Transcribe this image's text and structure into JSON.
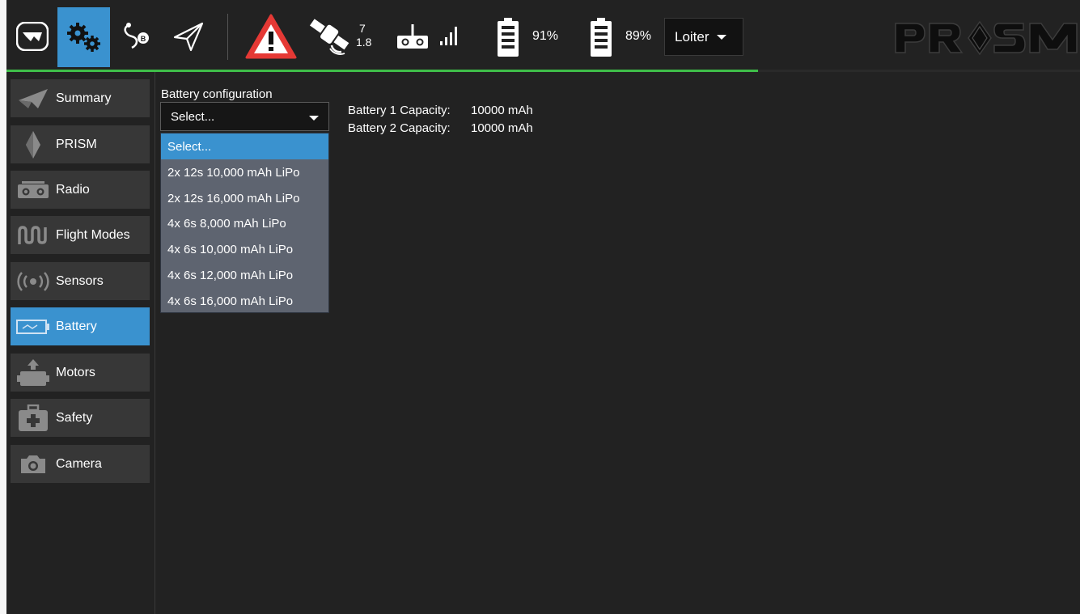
{
  "toolbar": {
    "gps_satellites": "7",
    "gps_hdop": "1.8",
    "battery1_percent": "91%",
    "battery2_percent": "89%",
    "flight_mode": "Loiter",
    "brand": "PRISM",
    "progress_fraction": 0.7,
    "colors": {
      "accent": "#3a92cf",
      "progress": "#3fbe49",
      "warning": "#e53935"
    }
  },
  "sidebar": {
    "items": [
      {
        "label": "Summary",
        "icon": "paper-plane-icon"
      },
      {
        "label": "PRISM",
        "icon": "prism-diamond-icon"
      },
      {
        "label": "Radio",
        "icon": "radio-icon"
      },
      {
        "label": "Flight Modes",
        "icon": "flight-modes-icon"
      },
      {
        "label": "Sensors",
        "icon": "sensors-icon"
      },
      {
        "label": "Battery",
        "icon": "battery-icon",
        "active": true
      },
      {
        "label": "Motors",
        "icon": "motors-icon"
      },
      {
        "label": "Safety",
        "icon": "safety-kit-icon"
      },
      {
        "label": "Camera",
        "icon": "camera-icon"
      }
    ]
  },
  "battery_config": {
    "label": "Battery configuration",
    "selected": "Select...",
    "options": [
      "Select...",
      "2x 12s 10,000 mAh LiPo",
      "2x 12s 16,000 mAh LiPo",
      "4x 6s 8,000 mAh LiPo",
      "4x 6s 10,000 mAh LiPo",
      "4x 6s 12,000 mAh LiPo",
      "4x 6s 16,000 mAh LiPo"
    ],
    "capacities": [
      {
        "label": "Battery 1 Capacity:",
        "value": "10000 mAh"
      },
      {
        "label": "Battery 2 Capacity:",
        "value": "10000 mAh"
      }
    ]
  }
}
